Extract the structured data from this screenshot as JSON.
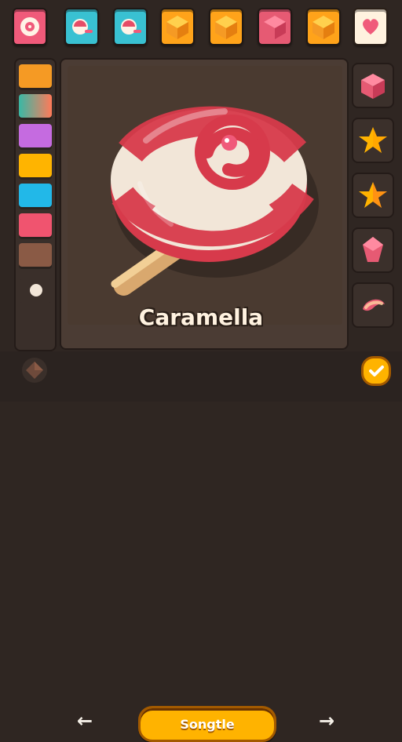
{
  "top_tiles": [
    {
      "label": "Target",
      "color": "#f05a7a"
    },
    {
      "label": "Lollipop",
      "color": "#39c1d2"
    },
    {
      "label": "Lollipop",
      "color": "#39c1d2"
    },
    {
      "label": "Cube",
      "color": "#ffa31a"
    },
    {
      "label": "Cube",
      "color": "#ffa31a"
    },
    {
      "label": "Cube",
      "color": "#e65a73"
    },
    {
      "label": "Cube",
      "color": "#ffa31a"
    },
    {
      "label": "Heart",
      "color": "#fff2df"
    }
  ],
  "left_swatches": [
    {
      "color": "#f59a24"
    },
    {
      "color": "#39b8a5"
    },
    {
      "color": "#c56be0"
    },
    {
      "color": "#ffb400"
    },
    {
      "color": "#22b8e8"
    },
    {
      "color": "#f0546f"
    },
    {
      "color": "#8a5a45"
    },
    {
      "color": "#f2e6d8"
    }
  ],
  "right_tiles": [
    {
      "label": "Cube"
    },
    {
      "label": "Star"
    },
    {
      "label": "Star"
    },
    {
      "label": "Gem"
    },
    {
      "label": "Jelly"
    }
  ],
  "title": "Caramella",
  "primary_button": "Songtle",
  "bottom": {
    "left_arrow": "←",
    "right_arrow": "→"
  }
}
